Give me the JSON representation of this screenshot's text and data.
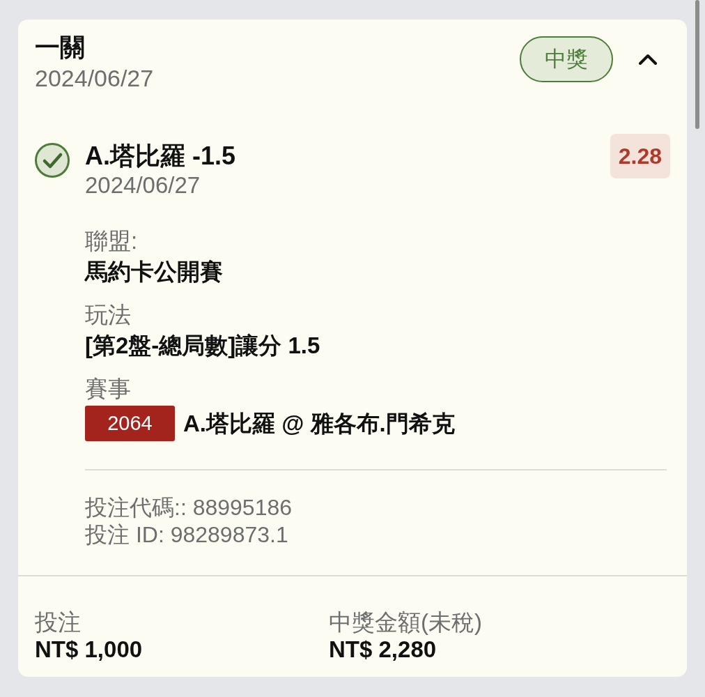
{
  "bet": {
    "type_label": "一關",
    "date": "2024/06/27",
    "status": {
      "label": "中獎",
      "kind": "won"
    },
    "expanded": true
  },
  "selections": [
    {
      "checked": true,
      "title": "A.塔比羅 -1.5",
      "date": "2024/06/27",
      "odds": "2.28",
      "details": [
        {
          "kind": "text",
          "label": "聯盟:",
          "value": "馬約卡公開賽"
        },
        {
          "kind": "text",
          "label": "玩法",
          "value": "[第2盤-總局數]讓分 1.5"
        },
        {
          "kind": "match",
          "label": "賽事",
          "match_code": "2064",
          "value": "A.塔比羅 @ 雅各布.門希克"
        }
      ]
    }
  ],
  "references": [
    "投注代碼:: 88995186",
    "投注 ID: 98289873.1"
  ],
  "summary": [
    {
      "label": "投注",
      "value": "NT$ 1,000"
    },
    {
      "label": "中獎金額(未稅)",
      "value": "NT$ 2,280"
    }
  ]
}
